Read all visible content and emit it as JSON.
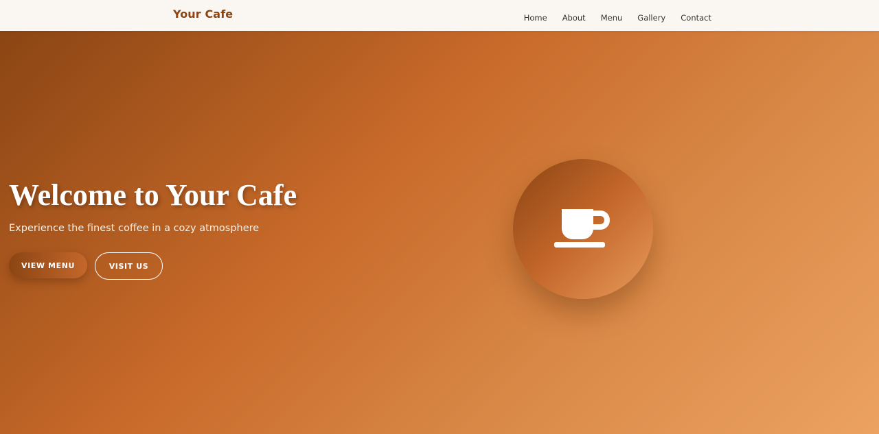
{
  "nav": {
    "brand": "Your Cafe",
    "links": [
      {
        "label": "Home"
      },
      {
        "label": "About"
      },
      {
        "label": "Menu"
      },
      {
        "label": "Gallery"
      },
      {
        "label": "Contact"
      }
    ]
  },
  "hero": {
    "title": "Welcome to Your Cafe",
    "subtitle": "Experience the finest coffee in a cozy atmosphere",
    "primary_button": "VIEW MENU",
    "secondary_button": "VISIT US",
    "icon": "coffee-cup-icon"
  },
  "colors": {
    "brand": "#8b4513",
    "accent": "#c86a2a",
    "nav_background": "#faf6f2",
    "hero_gradient_start": "#8b4513",
    "hero_gradient_end": "#eca262"
  }
}
